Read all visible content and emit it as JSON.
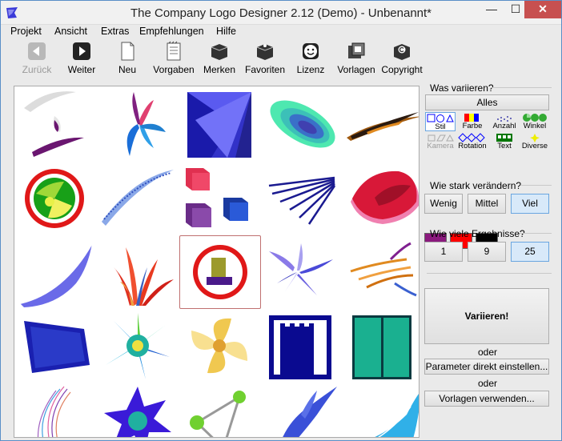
{
  "window": {
    "title": "The Company Logo Designer 2.12 (Demo) - Unbenannt*",
    "min_symbol": "—",
    "max_symbol": "☐",
    "close_symbol": "✕"
  },
  "menu": [
    "Projekt",
    "Ansicht",
    "Extras",
    "Empfehlungen",
    "Hilfe"
  ],
  "toolbar": [
    {
      "label": "Zurück",
      "icon": "back-arrow-icon",
      "enabled": false
    },
    {
      "label": "Weiter",
      "icon": "forward-arrow-icon",
      "enabled": true
    },
    {
      "label": "Neu",
      "icon": "new-document-icon",
      "enabled": true
    },
    {
      "label": "Vorgaben",
      "icon": "notepad-icon",
      "enabled": true
    },
    {
      "label": "Merken",
      "icon": "book-icon",
      "enabled": true
    },
    {
      "label": "Favoriten",
      "icon": "favorites-book-icon",
      "enabled": true
    },
    {
      "label": "Lizenz",
      "icon": "smiley-icon",
      "enabled": true
    },
    {
      "label": "Vorlagen",
      "icon": "templates-icon",
      "enabled": true
    },
    {
      "label": "Copyright",
      "icon": "copyright-book-icon",
      "enabled": true
    }
  ],
  "panel": {
    "vary_what_label": "Was variieren?",
    "all_button": "Alles",
    "categories": [
      {
        "label": "Stil",
        "icon": "style-shapes-icon",
        "selected": true,
        "enabled": true
      },
      {
        "label": "Farbe",
        "icon": "color-bars-icon",
        "selected": false,
        "enabled": true
      },
      {
        "label": "Anzahl",
        "icon": "count-dots-icon",
        "selected": false,
        "enabled": true
      },
      {
        "label": "Winkel",
        "icon": "angle-circles-icon",
        "selected": false,
        "enabled": true
      },
      {
        "label": "Kamera",
        "icon": "camera-shapes-icon",
        "selected": false,
        "enabled": false
      },
      {
        "label": "Rotation",
        "icon": "rotation-diamonds-icon",
        "selected": false,
        "enabled": true
      },
      {
        "label": "Text",
        "icon": "text-icon",
        "selected": false,
        "enabled": true
      },
      {
        "label": "Diverse",
        "icon": "misc-icon",
        "selected": false,
        "enabled": true
      }
    ],
    "colors": [
      "#8b1a7e",
      "#ff0000",
      "#000000"
    ],
    "strength_label": "Wie stark verändern?",
    "strength_options": [
      "Wenig",
      "Mittel",
      "Viel"
    ],
    "strength_selected": "Viel",
    "count_label": "Wie viele Ergebnisse?",
    "count_options": [
      "1",
      "9",
      "25"
    ],
    "count_selected": "25",
    "vary_button": "Variieren!",
    "or_1": "oder",
    "params_button": "Parameter direkt einstellen...",
    "or_2": "oder",
    "templates_button": "Vorlagen verwenden..."
  },
  "grid": {
    "columns": 5,
    "rows": 5,
    "selected_index": 12,
    "items": [
      "logo-swoosh-grey",
      "logo-blue-feathers",
      "logo-blue-rays-square",
      "logo-teal-ellipse",
      "logo-dark-brush",
      "logo-red-target-green",
      "logo-blue-wave-line",
      "logo-cubes",
      "logo-blue-fan-lines",
      "logo-red-pink-blob",
      "logo-blue-curve",
      "logo-red-flame",
      "logo-red-circle-olive",
      "logo-purple-fan",
      "logo-orange-spray",
      "logo-blue-cloud",
      "logo-multicolor-splat",
      "logo-yellow-pinwheel",
      "logo-blue-castle",
      "logo-teal-door",
      "logo-pink-threads",
      "logo-purple-star",
      "logo-green-balls",
      "logo-blue-hand",
      "logo-blue-wave"
    ]
  }
}
